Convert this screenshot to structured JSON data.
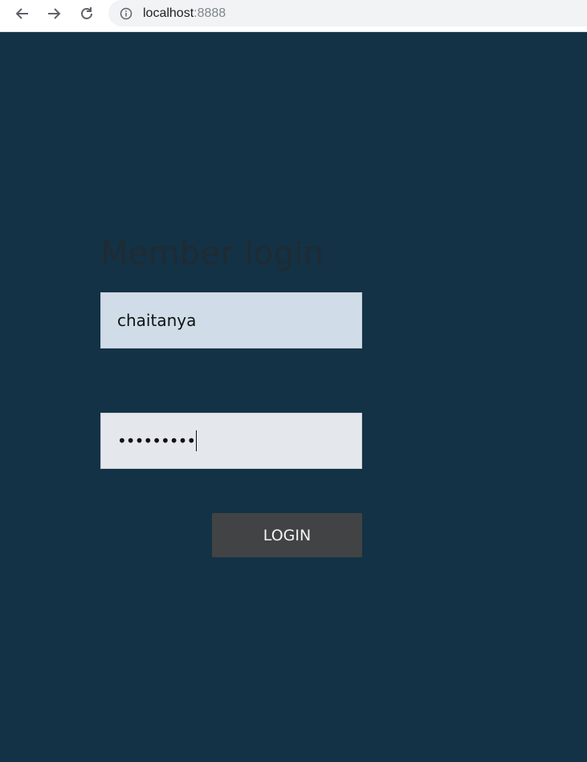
{
  "browser": {
    "url_host": "localhost",
    "url_port": ":8888",
    "icons": [
      "back-arrow-icon",
      "forward-arrow-icon",
      "reload-icon",
      "info-icon"
    ]
  },
  "form": {
    "title": "Member login",
    "username_value": "chaitanya",
    "password_mask": "•••••••••",
    "login_label": "LOGIN"
  },
  "colors": {
    "page_bg": "#133246",
    "username_bg": "#d0dde9",
    "password_bg": "#e4e8ed",
    "button_bg": "#424345"
  }
}
